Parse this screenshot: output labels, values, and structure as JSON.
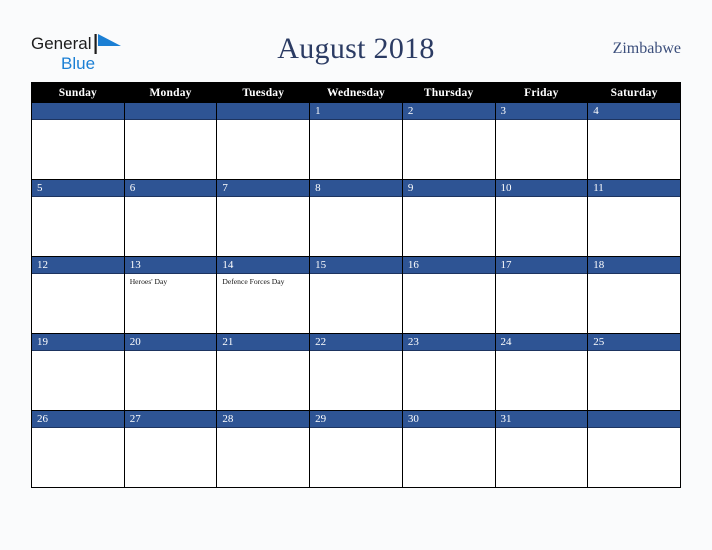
{
  "brand": {
    "name_top": "General",
    "name_bottom": "Blue",
    "color_dark": "#1d1d1d",
    "color_blue": "#1b7fd4",
    "icon": "general-blue-logo"
  },
  "header": {
    "title": "August 2018",
    "country": "Zimbabwe",
    "title_color": "#2b3b63",
    "country_color": "#3c4f7c"
  },
  "theme": {
    "header_bg": "#000000",
    "header_text": "#ffffff",
    "date_strip_bg": "#2e5494",
    "date_text": "#ffffff",
    "cell_bg": "#ffffff",
    "grid_line": "#000000",
    "page_bg": "#fafbfc"
  },
  "weekday_headers": [
    "Sunday",
    "Monday",
    "Tuesday",
    "Wednesday",
    "Thursday",
    "Friday",
    "Saturday"
  ],
  "weeks": [
    [
      {
        "day": "",
        "events": []
      },
      {
        "day": "",
        "events": []
      },
      {
        "day": "",
        "events": []
      },
      {
        "day": "1",
        "events": []
      },
      {
        "day": "2",
        "events": []
      },
      {
        "day": "3",
        "events": []
      },
      {
        "day": "4",
        "events": []
      }
    ],
    [
      {
        "day": "5",
        "events": []
      },
      {
        "day": "6",
        "events": []
      },
      {
        "day": "7",
        "events": []
      },
      {
        "day": "8",
        "events": []
      },
      {
        "day": "9",
        "events": []
      },
      {
        "day": "10",
        "events": []
      },
      {
        "day": "11",
        "events": []
      }
    ],
    [
      {
        "day": "12",
        "events": []
      },
      {
        "day": "13",
        "events": [
          "Heroes' Day"
        ]
      },
      {
        "day": "14",
        "events": [
          "Defence Forces Day"
        ]
      },
      {
        "day": "15",
        "events": []
      },
      {
        "day": "16",
        "events": []
      },
      {
        "day": "17",
        "events": []
      },
      {
        "day": "18",
        "events": []
      }
    ],
    [
      {
        "day": "19",
        "events": []
      },
      {
        "day": "20",
        "events": []
      },
      {
        "day": "21",
        "events": []
      },
      {
        "day": "22",
        "events": []
      },
      {
        "day": "23",
        "events": []
      },
      {
        "day": "24",
        "events": []
      },
      {
        "day": "25",
        "events": []
      }
    ],
    [
      {
        "day": "26",
        "events": []
      },
      {
        "day": "27",
        "events": []
      },
      {
        "day": "28",
        "events": []
      },
      {
        "day": "29",
        "events": []
      },
      {
        "day": "30",
        "events": []
      },
      {
        "day": "31",
        "events": []
      },
      {
        "day": "",
        "events": []
      }
    ]
  ]
}
